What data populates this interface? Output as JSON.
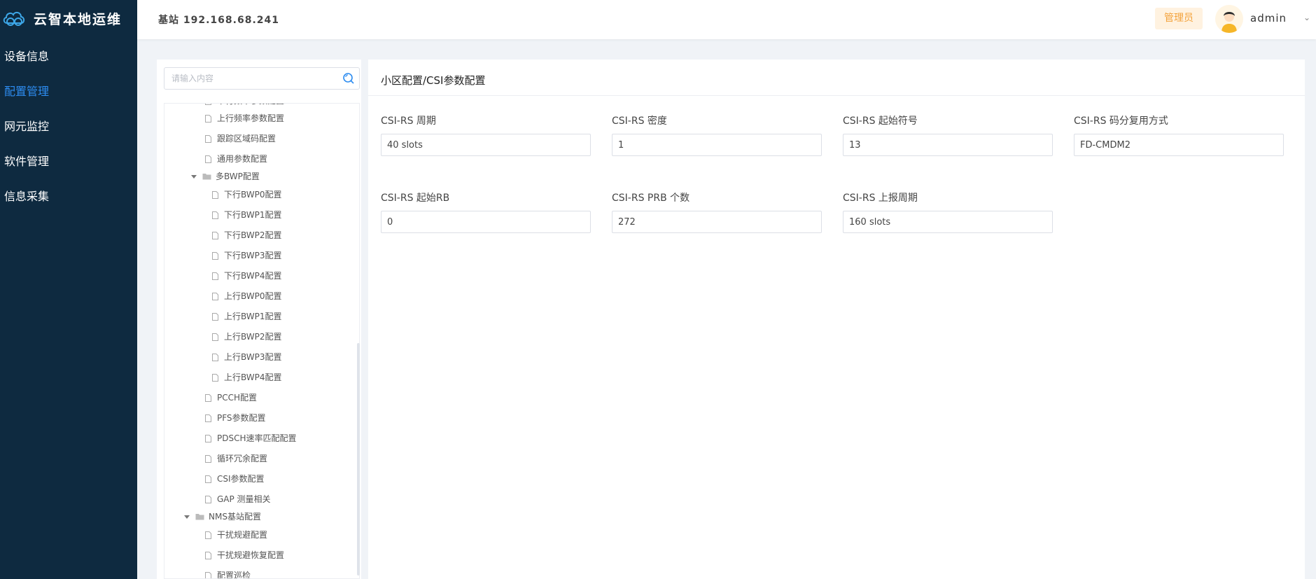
{
  "sidebar": {
    "logo_text": "云智本地运维",
    "items": [
      {
        "label": "设备信息"
      },
      {
        "label": "配置管理"
      },
      {
        "label": "网元监控"
      },
      {
        "label": "软件管理"
      },
      {
        "label": "信息采集"
      }
    ]
  },
  "header": {
    "station": "基站 192.168.68.241",
    "role": "管理员",
    "username": "admin"
  },
  "tree": {
    "search_placeholder": "请输入内容",
    "rows": [
      {
        "label": "下行频率参数配置",
        "type": "file",
        "level": 2
      },
      {
        "label": "上行频率参数配置",
        "type": "file",
        "level": 2
      },
      {
        "label": "跟踪区域码配置",
        "type": "file",
        "level": 2
      },
      {
        "label": "通用参数配置",
        "type": "file",
        "level": 2
      },
      {
        "label": "多BWP配置",
        "type": "folder",
        "level": 2
      },
      {
        "label": "下行BWP0配置",
        "type": "file",
        "level": 3
      },
      {
        "label": "下行BWP1配置",
        "type": "file",
        "level": 3
      },
      {
        "label": "下行BWP2配置",
        "type": "file",
        "level": 3
      },
      {
        "label": "下行BWP3配置",
        "type": "file",
        "level": 3
      },
      {
        "label": "下行BWP4配置",
        "type": "file",
        "level": 3
      },
      {
        "label": "上行BWP0配置",
        "type": "file",
        "level": 3
      },
      {
        "label": "上行BWP1配置",
        "type": "file",
        "level": 3
      },
      {
        "label": "上行BWP2配置",
        "type": "file",
        "level": 3
      },
      {
        "label": "上行BWP3配置",
        "type": "file",
        "level": 3
      },
      {
        "label": "上行BWP4配置",
        "type": "file",
        "level": 3
      },
      {
        "label": "PCCH配置",
        "type": "file",
        "level": 2
      },
      {
        "label": "PFS参数配置",
        "type": "file",
        "level": 2
      },
      {
        "label": "PDSCH速率匹配配置",
        "type": "file",
        "level": 2
      },
      {
        "label": "循环冗余配置",
        "type": "file",
        "level": 2
      },
      {
        "label": "CSI参数配置",
        "type": "file",
        "level": 2
      },
      {
        "label": "GAP 测量相关",
        "type": "file",
        "level": 2
      },
      {
        "label": "NMS基站配置",
        "type": "folder",
        "level": 1
      },
      {
        "label": "干扰规避配置",
        "type": "file",
        "level": 2
      },
      {
        "label": "干扰规避恢复配置",
        "type": "file",
        "level": 2
      },
      {
        "label": "配置巡检",
        "type": "file",
        "level": 2
      }
    ]
  },
  "main": {
    "title": "小区配置/CSI参数配置",
    "fields": [
      {
        "label": "CSI-RS 周期",
        "value": "40 slots"
      },
      {
        "label": "CSI-RS 密度",
        "value": "1"
      },
      {
        "label": "CSI-RS 起始符号",
        "value": "13"
      },
      {
        "label": "CSI-RS 码分复用方式",
        "value": "FD-CMDM2"
      },
      {
        "label": "CSI-RS 起始RB",
        "value": "0"
      },
      {
        "label": "CSI-RS PRB 个数",
        "value": "272"
      },
      {
        "label": "CSI-RS 上报周期",
        "value": "160 slots"
      }
    ]
  },
  "colors": {
    "sidebar_bg": "#0e2a40",
    "accent": "#2d8cf0",
    "role_badge_bg": "#fff2e0",
    "role_badge_text": "#f3a23a"
  }
}
